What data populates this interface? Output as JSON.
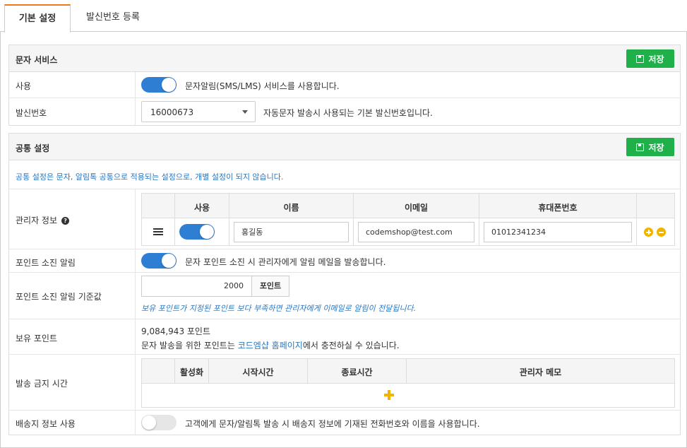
{
  "tabs": [
    "기본 설정",
    "발신번호 등록"
  ],
  "sms_panel": {
    "title": "문자 서비스",
    "save_label": "저장",
    "rows": {
      "use": {
        "label": "사용",
        "toggle_on": true,
        "desc": "문자알림(SMS/LMS) 서비스를 사용합니다."
      },
      "sender": {
        "label": "발신번호",
        "selected": "16000673",
        "desc": "자동문자 발송시 사용되는 기본 발신번호입니다."
      }
    }
  },
  "common_panel": {
    "title": "공통 설정",
    "save_label": "저장",
    "notice": "공통 설정은 문자, 알림톡 공통으로 적용되는 설정으로, 개별 설정이 되지 않습니다.",
    "admin": {
      "label": "관리자 정보",
      "help_icon": "question-circle-icon",
      "columns": [
        "사용",
        "이름",
        "이메일",
        "휴대폰번호"
      ],
      "row": {
        "toggle_on": true,
        "name": "홍길동",
        "email": "codemshop@test.com",
        "phone": "01012341234"
      }
    },
    "point_alert": {
      "label": "포인트 소진 알림",
      "toggle_on": true,
      "desc": "문자 포인트 소진 시 관리자에게 알림 메일을 발송합니다."
    },
    "point_threshold": {
      "label": "포인트 소진 알림 기준값",
      "value": "2000",
      "unit": "포인트",
      "note": "보유 포인트가 지정된 포인트 보다 부족하면 관리자에게 이메일로 알림이 전달됩니다."
    },
    "points_held": {
      "label": "보유 포인트",
      "amount": "9,084,943 포인트",
      "desc_prefix": "문자 발송을 위한 포인트는 ",
      "desc_link": "코드엠샵 홈페이지",
      "desc_suffix": "에서 충전하실 수 있습니다."
    },
    "block_time": {
      "label": "발송 금지 시간",
      "columns": [
        "활성화",
        "시작시간",
        "종료시간",
        "관리자 메모"
      ]
    },
    "shipping": {
      "label": "배송지 정보 사용",
      "toggle_on": false,
      "desc": "고객에게 문자/알림톡 발송 시 배송지 정보에 기재된 전화번호와 이름을 사용합니다."
    }
  },
  "colors": {
    "accent_tab": "#ea7a1a",
    "save_button": "#1fb04a",
    "toggle_on": "#2e7fd4",
    "note_blue": "#2a78c2",
    "icon_yellow": "#f0b400"
  }
}
